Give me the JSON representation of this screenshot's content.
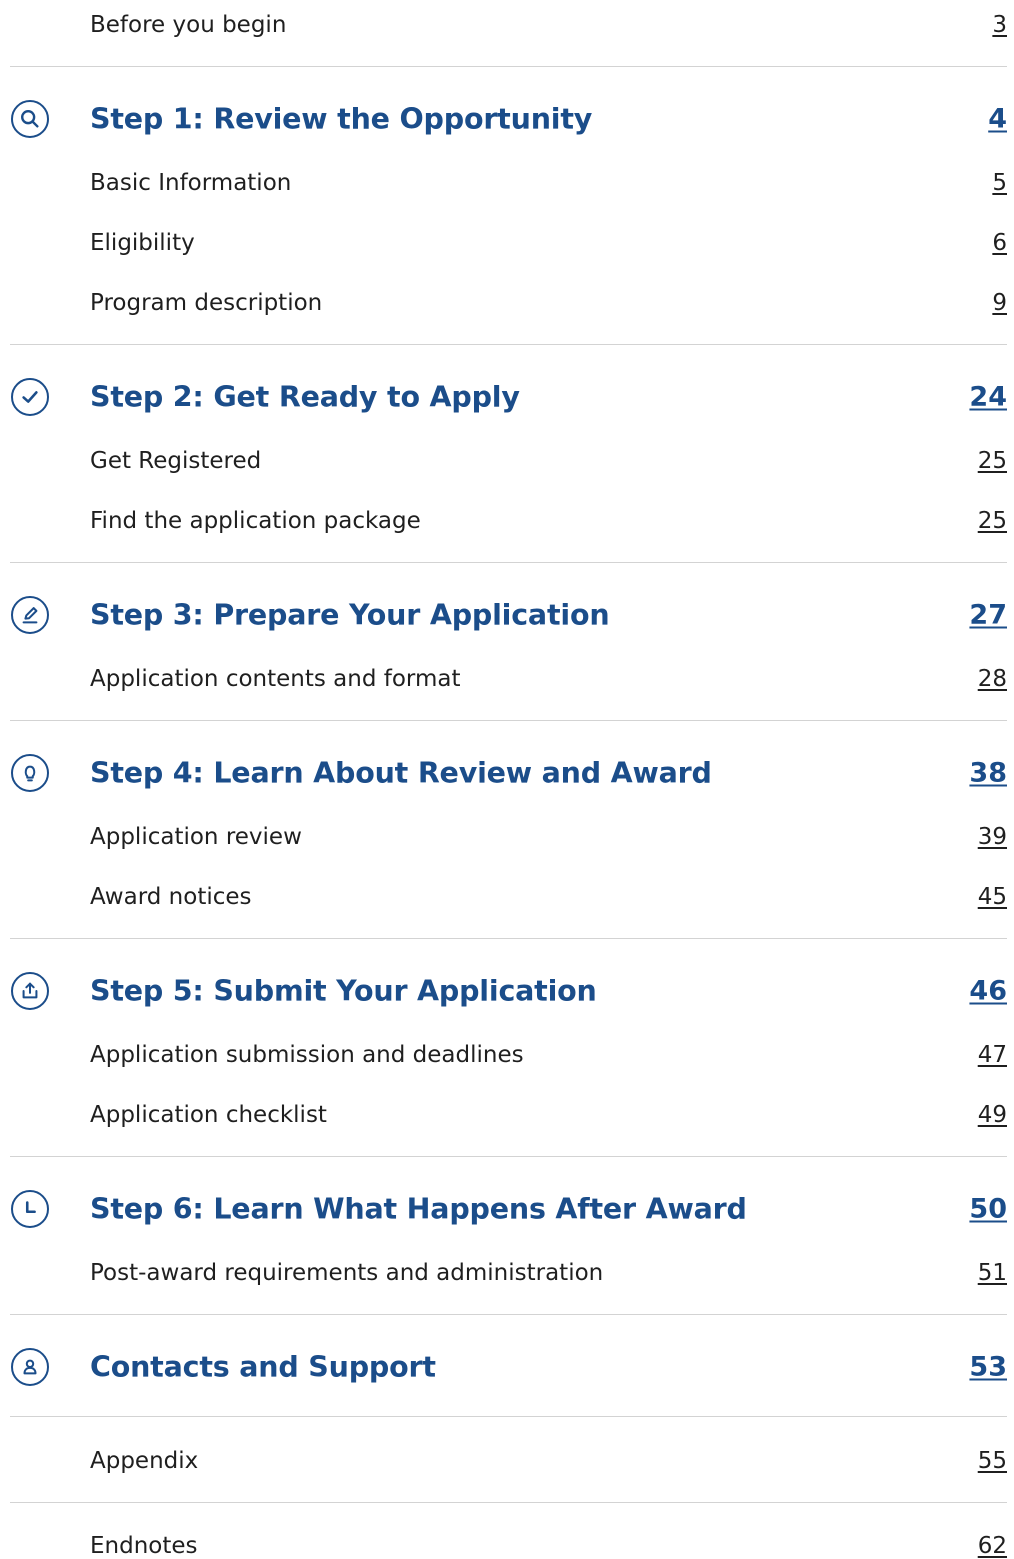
{
  "toc": {
    "before": {
      "label": "Before you begin",
      "page": "3"
    },
    "step1": {
      "label": "Step 1: Review the Opportunity",
      "page": "4",
      "icon": "search-icon",
      "items": [
        {
          "label": "Basic Information",
          "page": "5"
        },
        {
          "label": "Eligibility",
          "page": "6"
        },
        {
          "label": "Program description",
          "page": "9"
        }
      ]
    },
    "step2": {
      "label": "Step 2: Get Ready to Apply",
      "page": "24",
      "icon": "check-icon",
      "items": [
        {
          "label": "Get Registered",
          "page": "25"
        },
        {
          "label": "Find the application package",
          "page": "25"
        }
      ]
    },
    "step3": {
      "label": "Step 3: Prepare Your Application",
      "page": "27",
      "icon": "pencil-icon",
      "items": [
        {
          "label": "Application contents and format",
          "page": "28"
        }
      ]
    },
    "step4": {
      "label": "Step 4: Learn About Review and Award",
      "page": "38",
      "icon": "lightbulb-icon",
      "items": [
        {
          "label": "Application review",
          "page": "39"
        },
        {
          "label": "Award notices",
          "page": "45"
        }
      ]
    },
    "step5": {
      "label": "Step 5: Submit Your Application",
      "page": "46",
      "icon": "upload-icon",
      "items": [
        {
          "label": "Application submission and deadlines",
          "page": "47"
        },
        {
          "label": "Application checklist",
          "page": "49"
        }
      ]
    },
    "step6": {
      "label": "Step 6: Learn What Happens After Award",
      "page": "50",
      "icon": "clock-icon",
      "items": [
        {
          "label": "Post-award requirements and administration",
          "page": "51"
        }
      ]
    },
    "contacts": {
      "label": "Contacts and Support",
      "page": "53",
      "icon": "person-icon"
    },
    "appendix": {
      "label": "Appendix",
      "page": "55"
    },
    "endnotes": {
      "label": "Endnotes",
      "page": "62"
    }
  },
  "colors": {
    "heading": "#1b4d8a",
    "text": "#1f1f1f",
    "divider": "#d3d3d3"
  }
}
